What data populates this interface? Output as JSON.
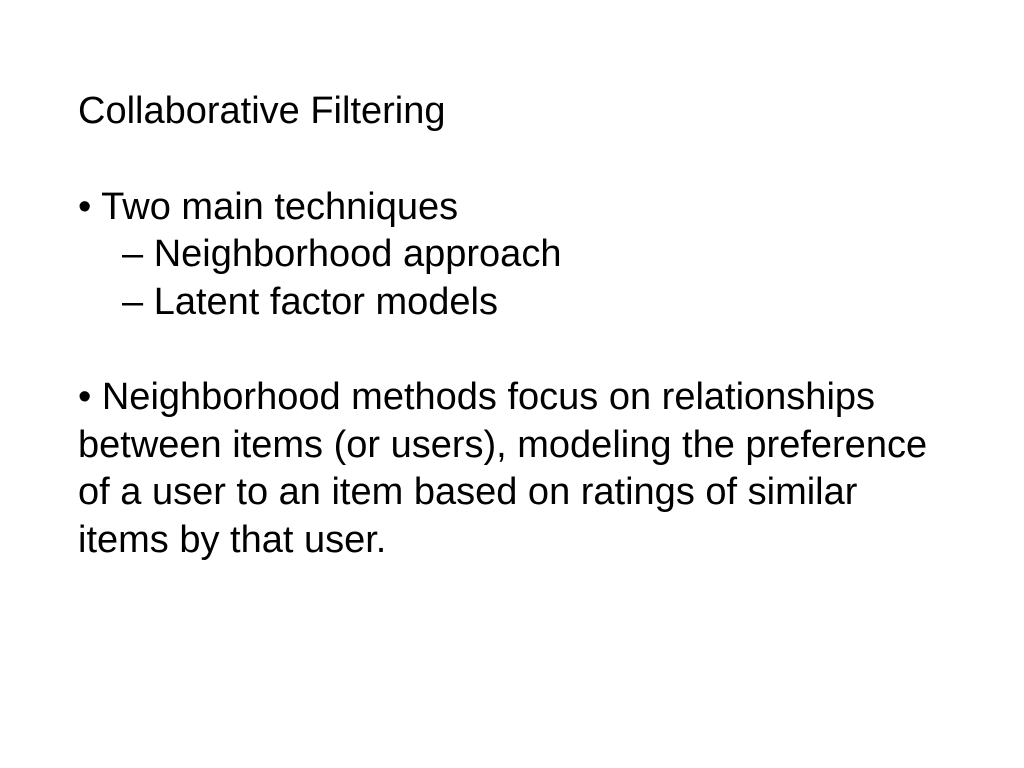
{
  "slide": {
    "title": "Collaborative Filtering",
    "bullet1": {
      "label": "• Two main techniques",
      "sub1": "– Neighborhood approach",
      "sub2": "– Latent factor models"
    },
    "bullet2": "• Neighborhood methods focus on relationships between items (or users), modeling the preference of a user to an item based on ratings of similar items by that user."
  }
}
